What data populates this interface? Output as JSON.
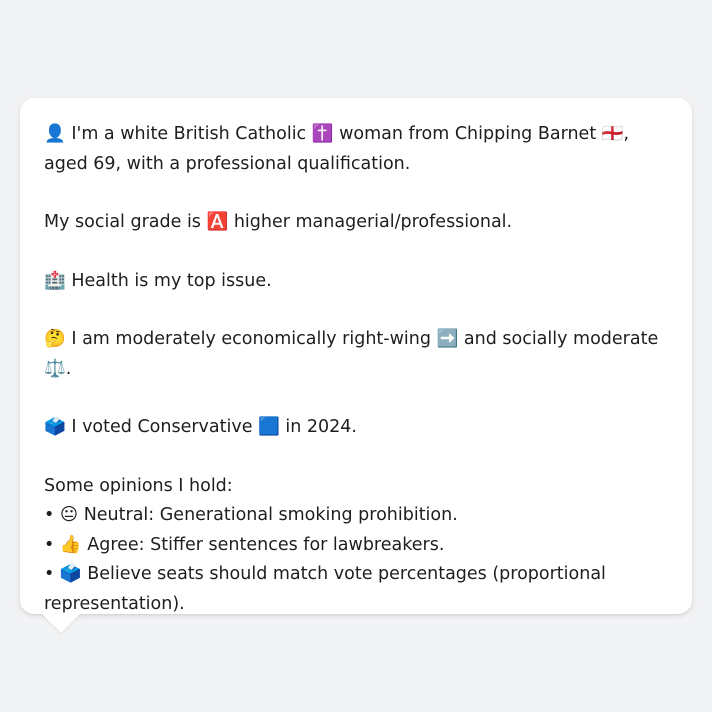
{
  "profile": {
    "intro": "👤 I'm a white British Catholic ✝️ woman from Chipping Barnet 🏴󠁧󠁢󠁥󠁮󠁧󠁿, aged 69, with a professional qualification.",
    "social_grade": "My social grade is 🅰️ higher managerial/professional.",
    "top_issue": "🏥 Health is my top issue.",
    "ideology": "🤔 I am moderately economically right-wing ➡️ and socially moderate ⚖️.",
    "vote": "🗳️ I voted Conservative 🟦 in 2024."
  },
  "opinions": {
    "heading": "Some opinions I hold:",
    "items": [
      "• 😐 Neutral: Generational smoking prohibition.",
      "• 👍 Agree: Stiffer sentences for lawbreakers.",
      "• 🗳️ Believe seats should match vote percentages (proportional representation)."
    ]
  }
}
